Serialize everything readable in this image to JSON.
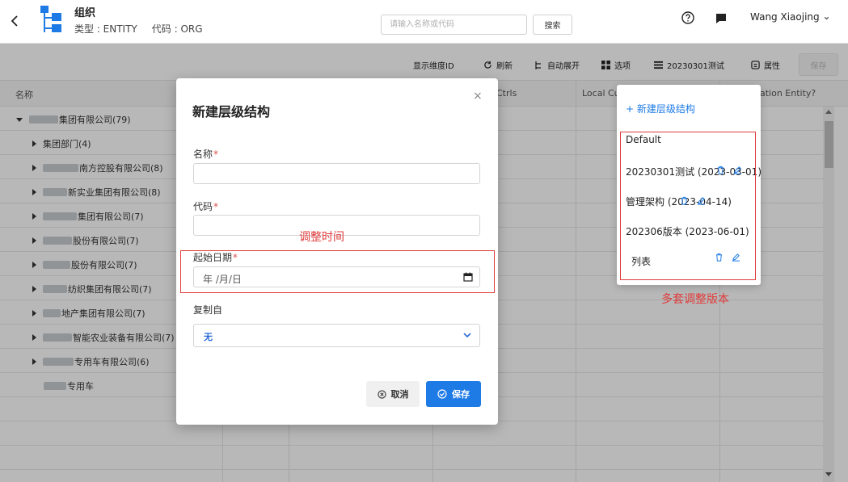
{
  "header": {
    "title": "组织",
    "type_label": "类型 : ENTITY",
    "code_label": "代码 : ORG",
    "search_placeholder": "请输入名称或代码",
    "search_button": "搜索",
    "user_name": "Wang Xiaojing"
  },
  "toolbar": {
    "show_dim_id": "显示维度ID",
    "refresh": "刷新",
    "auto_expand": "自动展开",
    "options": "选项",
    "hierarchy": "20230301测试",
    "properties": "属性",
    "save": "保存"
  },
  "grid": {
    "columns": {
      "name": "名称",
      "ctrls": "Ctrls",
      "local_cu": "Local Cu",
      "elimination": "ation Entity?"
    },
    "rows": [
      {
        "label": "集团有限公司(79)",
        "level": 0,
        "expanded": true
      },
      {
        "label": "集团部门(4)",
        "level": 1,
        "expanded": false
      },
      {
        "label": "南方控股有限公司(8)",
        "level": 1,
        "expanded": false
      },
      {
        "label": "新实业集团有限公司(8)",
        "level": 1,
        "expanded": false
      },
      {
        "label": "集团有限公司(7)",
        "level": 1,
        "expanded": false
      },
      {
        "label": "股份有限公司(7)",
        "level": 1,
        "expanded": false
      },
      {
        "label": "股份有限公司(7)",
        "level": 1,
        "expanded": false
      },
      {
        "label": "纺织集团有限公司(7)",
        "level": 1,
        "expanded": false
      },
      {
        "label": "地产集团有限公司(7)",
        "level": 1,
        "expanded": false
      },
      {
        "label": "智能农业装备有限公司(7)",
        "level": 1,
        "expanded": false
      },
      {
        "label": "专用车有限公司(6)",
        "level": 1,
        "expanded": false
      },
      {
        "label": "专用车",
        "level": 1,
        "expanded": null
      },
      {
        "label": "",
        "level": 1,
        "expanded": null
      },
      {
        "label": "",
        "level": 1,
        "expanded": null
      },
      {
        "label": "",
        "level": 1,
        "expanded": null
      }
    ]
  },
  "modal": {
    "title": "新建层级结构",
    "name_label": "名称",
    "code_label": "代码",
    "start_date_label": "起始日期",
    "required_mark": "*",
    "date_placeholder": "年 /月/日",
    "copy_from_label": "复制自",
    "copy_from_value": "无",
    "cancel": "取消",
    "save": "保存",
    "close": "×"
  },
  "dropdown": {
    "new_item": "+ 新建层级结构",
    "items": [
      {
        "label": "Default"
      },
      {
        "label": "20230301测试 (2023-03-01)"
      },
      {
        "label": "管理架构 (2023-04-14)"
      },
      {
        "label": "202306版本 (2023-06-01)"
      },
      {
        "label": "列表"
      }
    ]
  },
  "annotations": {
    "adjust_time": "调整时间",
    "multi_versions": "多套调整版本"
  },
  "colors": {
    "accent": "#1e7be6",
    "annotation": "#e03b3b",
    "select_text": "#2a6ad6"
  }
}
